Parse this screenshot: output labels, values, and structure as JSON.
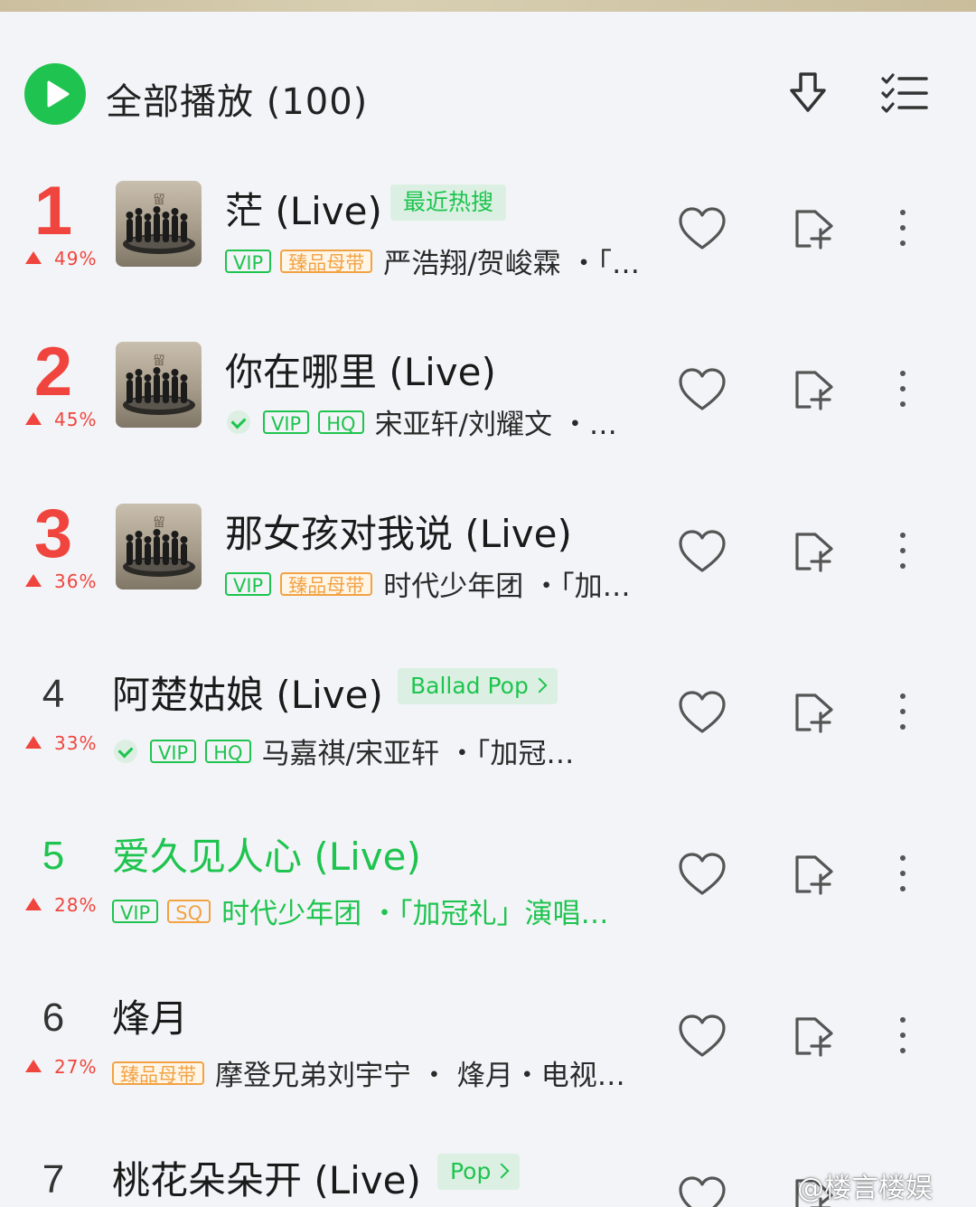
{
  "header": {
    "play_all_label": "全部播放 (100)",
    "icons": {
      "play": "play-icon",
      "download": "download-icon",
      "multiselect": "multiselect-list-icon"
    },
    "accent_color": "#1ec44f"
  },
  "songs": [
    {
      "rank": "1",
      "trend_pct": "49%",
      "title": "茫 (Live)",
      "tag": "最近热搜",
      "badges": [
        "VIP",
        "臻品母带"
      ],
      "meta": "严浩翔/贺峻霖 ・「…"
    },
    {
      "rank": "2",
      "trend_pct": "45%",
      "title": "你在哪里 (Live)",
      "tag": "",
      "badges": [
        "VIP",
        "HQ"
      ],
      "meta": "宋亚轩/刘耀文 ・…"
    },
    {
      "rank": "3",
      "trend_pct": "36%",
      "title": "那女孩对我说 (Live)",
      "tag": "",
      "badges": [
        "VIP",
        "臻品母带"
      ],
      "meta": "时代少年团 ・「加…"
    },
    {
      "rank": "4",
      "trend_pct": "33%",
      "title": "阿楚姑娘 (Live)",
      "tag": "Ballad Pop",
      "badges": [
        "VIP",
        "HQ"
      ],
      "meta": "马嘉祺/宋亚轩 ・「加冠…"
    },
    {
      "rank": "5",
      "trend_pct": "28%",
      "title": "爱久见人心 (Live)",
      "tag": "",
      "badges": [
        "VIP",
        "SQ"
      ],
      "meta": "时代少年团 ・「加冠礼」演唱…"
    },
    {
      "rank": "6",
      "trend_pct": "27%",
      "title": "烽月",
      "tag": "",
      "badges": [
        "臻品母带"
      ],
      "meta": "摩登兄弟刘宇宁 ・ 烽月・电视…"
    },
    {
      "rank": "7",
      "trend_pct": "",
      "title": "桃花朵朵开 (Live)",
      "tag": "Pop",
      "badges": [],
      "meta": ""
    }
  ],
  "row_icons": {
    "like": "heart-icon",
    "add": "add-to-playlist-icon",
    "more": "more-vertical-icon"
  },
  "watermark": "@楼言楼娱"
}
